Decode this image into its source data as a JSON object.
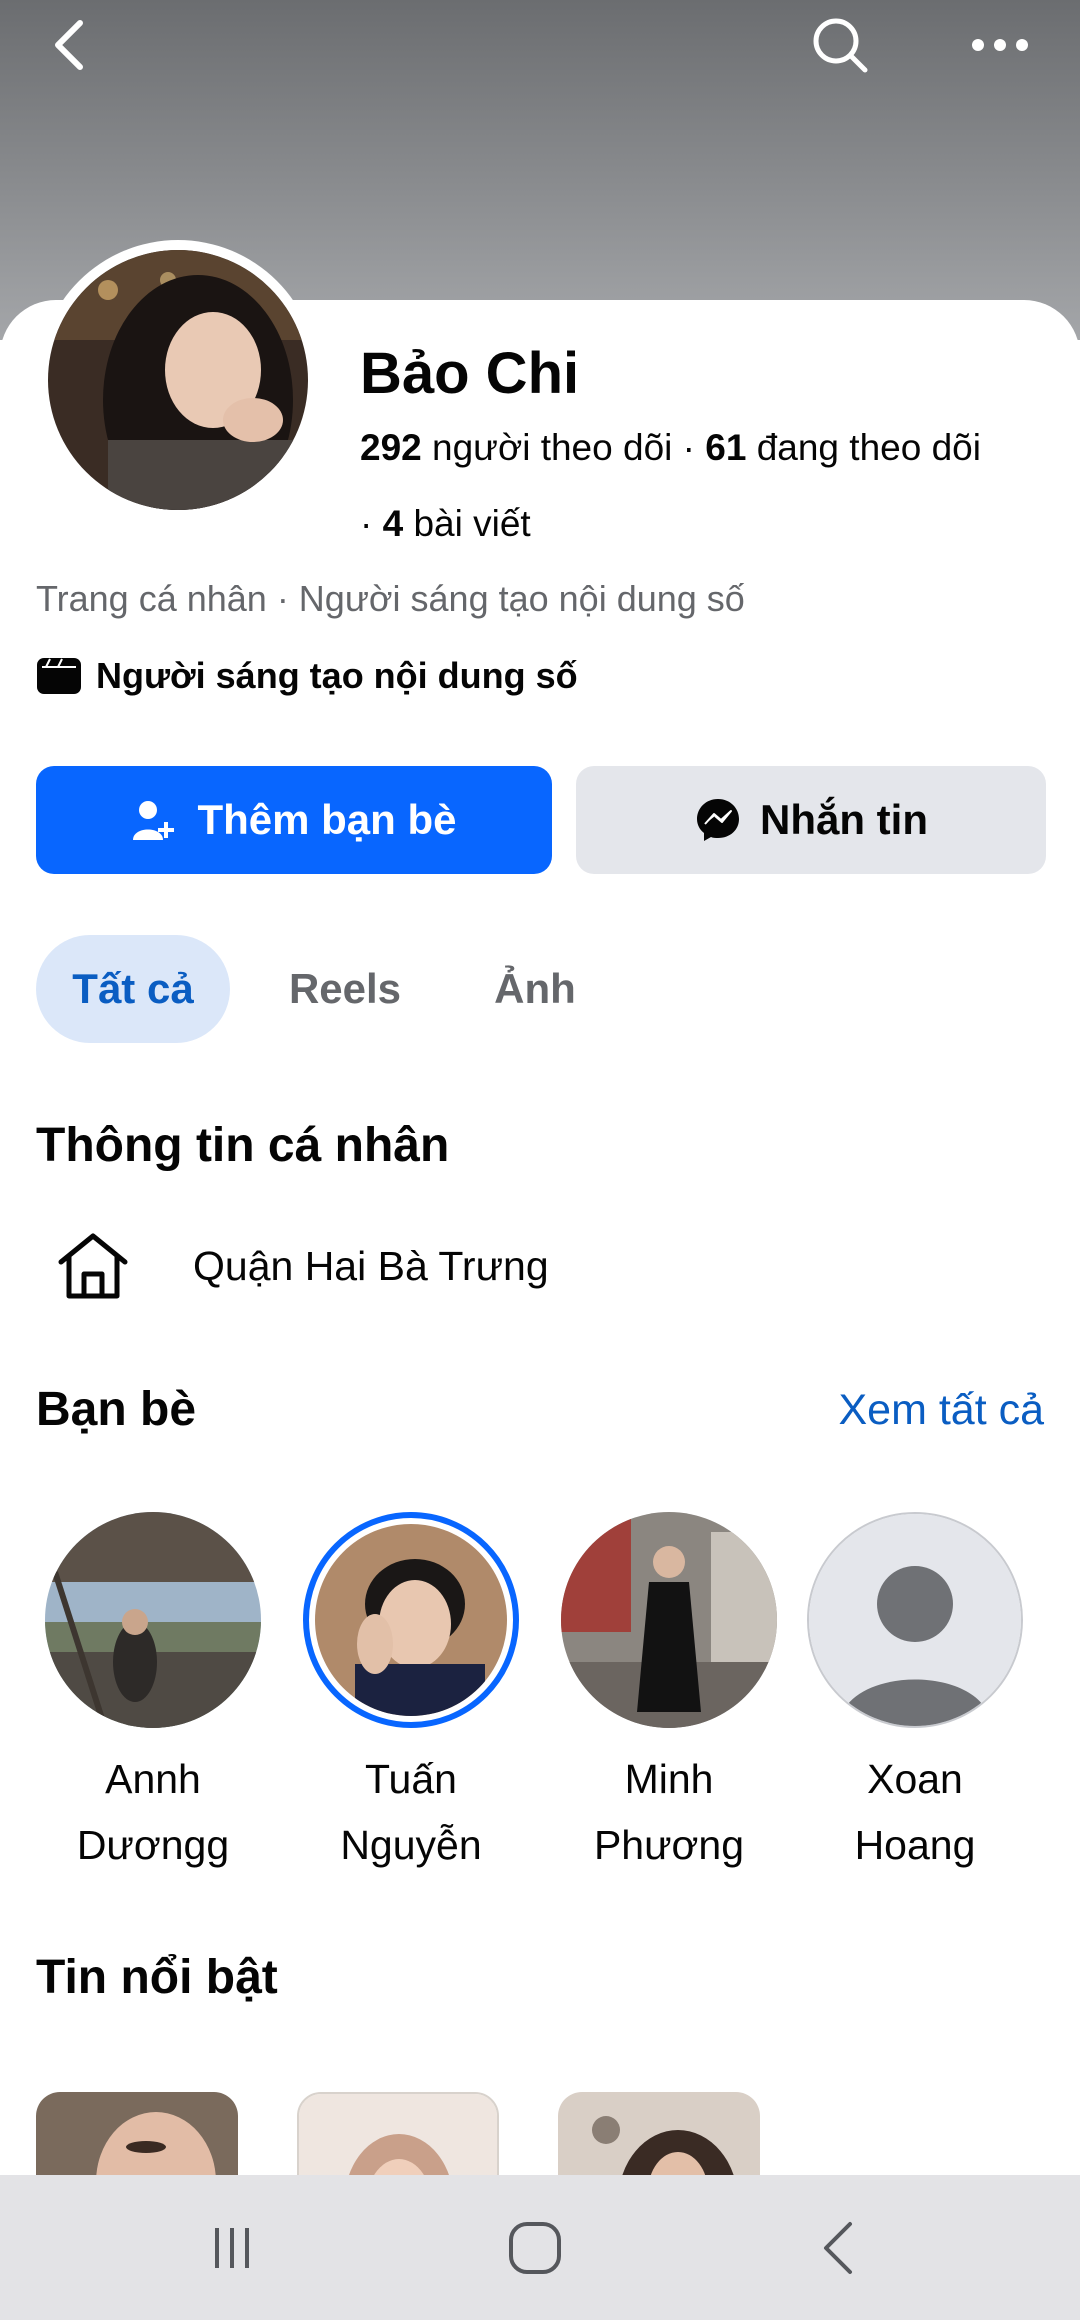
{
  "profile": {
    "name": "Bảo Chi",
    "followers_count": "292",
    "followers_label": "người theo dõi",
    "following_count": "61",
    "following_label": "đang theo dõi",
    "posts_count": "4",
    "posts_label": "bài viết",
    "category": "Trang cá nhân · Người sáng tạo nội dung số",
    "creator_badge": "Người sáng tạo nội dung số"
  },
  "actions": {
    "add_friend": "Thêm bạn bè",
    "message": "Nhắn tin"
  },
  "tabs": [
    {
      "label": "Tất cả",
      "active": true
    },
    {
      "label": "Reels",
      "active": false
    },
    {
      "label": "Ảnh",
      "active": false
    }
  ],
  "info": {
    "title": "Thông tin cá nhân",
    "location": "Quận Hai Bà Trưng"
  },
  "friends": {
    "title": "Bạn bè",
    "see_all": "Xem tất cả",
    "items": [
      {
        "line1": "Annh",
        "line2": "Dươngg"
      },
      {
        "line1": "Tuấn",
        "line2": "Nguyễn"
      },
      {
        "line1": "Minh",
        "line2": "Phương"
      },
      {
        "line1": "Xoan",
        "line2": "Hoang"
      }
    ]
  },
  "highlights": {
    "title": "Tin nổi bật"
  },
  "colors": {
    "primary": "#0866ff",
    "link": "#0a5dc2",
    "tab_active_bg": "#dbe7f9",
    "secondary_btn": "#e4e6eb"
  },
  "icons": [
    "back-arrow-icon",
    "search-icon",
    "more-icon",
    "add-friend-icon",
    "messenger-icon",
    "clapperboard-icon",
    "home-icon",
    "recent-apps-icon",
    "home-nav-icon",
    "back-nav-icon"
  ]
}
